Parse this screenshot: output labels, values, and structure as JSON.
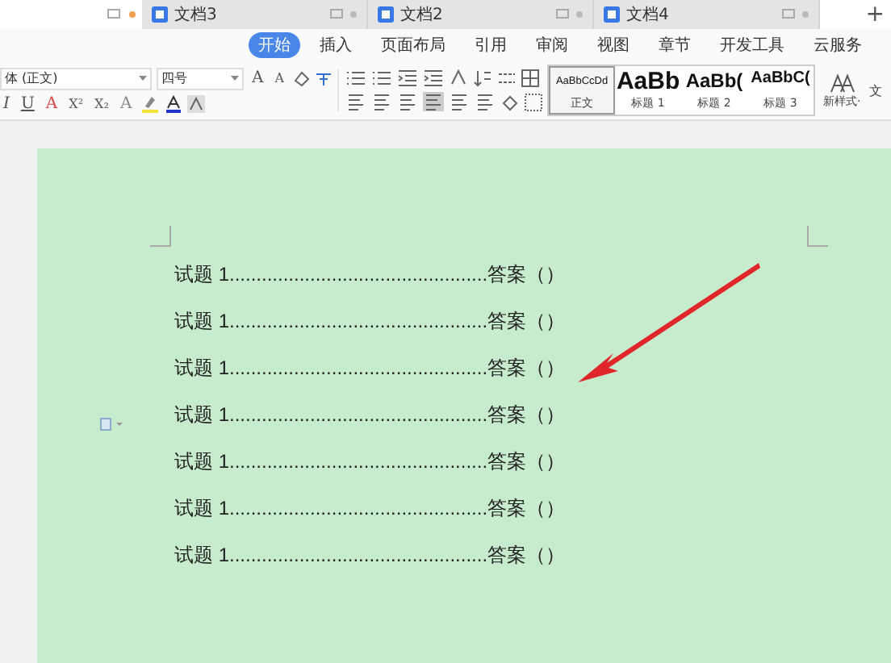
{
  "doc_tabs": [
    {
      "title": "文档3"
    },
    {
      "title": "文档2"
    },
    {
      "title": "文档4"
    }
  ],
  "new_tab": "+",
  "ribbon_tabs": [
    {
      "label": "开始",
      "selected": true
    },
    {
      "label": "插入",
      "selected": false
    },
    {
      "label": "页面布局",
      "selected": false
    },
    {
      "label": "引用",
      "selected": false
    },
    {
      "label": "审阅",
      "selected": false
    },
    {
      "label": "视图",
      "selected": false
    },
    {
      "label": "章节",
      "selected": false
    },
    {
      "label": "开发工具",
      "selected": false
    },
    {
      "label": "云服务",
      "selected": false
    }
  ],
  "font": {
    "name": "体 (正文)",
    "size": "四号"
  },
  "format_row1": [
    {
      "label": "A",
      "kind": "grow"
    },
    {
      "label": "A",
      "kind": "shrink"
    }
  ],
  "format_row2": [
    {
      "label": "I",
      "kind": "italic"
    },
    {
      "label": "U",
      "kind": "underline"
    },
    {
      "label": "A",
      "kind": "color"
    },
    {
      "label": "X²",
      "kind": "sup"
    },
    {
      "label": "X₂",
      "kind": "sub"
    },
    {
      "label": "A",
      "kind": "outline"
    }
  ],
  "styles": [
    {
      "sample": "AaBbCcDd",
      "name": "正文",
      "kind": "small",
      "selected": true
    },
    {
      "sample": "AaBb",
      "name": "标题 1",
      "kind": "h1",
      "selected": false
    },
    {
      "sample": "AaBb(",
      "name": "标题 2",
      "kind": "h2",
      "selected": false
    },
    {
      "sample": "AaBbC(",
      "name": "标题 3",
      "kind": "h3",
      "selected": false
    }
  ],
  "new_style": "新样式·",
  "text_tool": "文",
  "lines": [
    "试题 1................................................答案（）",
    "试题 1................................................答案（）",
    "试题 1................................................答案（）",
    "试题 1................................................答案（）",
    "试题 1................................................答案（）",
    "试题 1................................................答案（）",
    "试题 1................................................答案（）"
  ]
}
